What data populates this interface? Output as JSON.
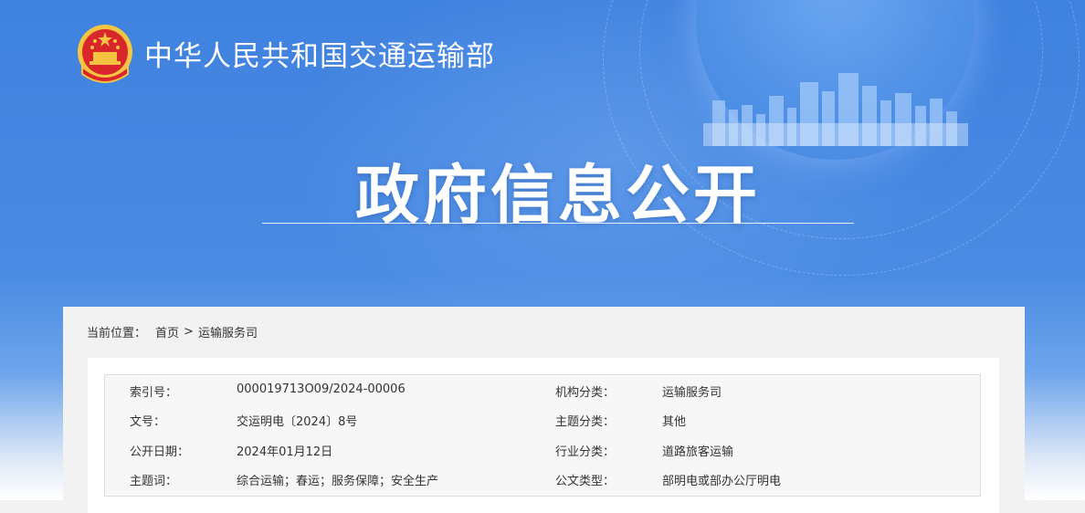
{
  "header": {
    "site_title": "中华人民共和国交通运输部",
    "page_title": "政府信息公开"
  },
  "breadcrumb": {
    "label": "当前位置：",
    "items": [
      "首页",
      "运输服务司"
    ],
    "separator": ">"
  },
  "meta": {
    "rows": [
      {
        "k1": "索引号：",
        "v1": "000019713O09/2024-00006",
        "k2": "机构分类：",
        "v2": "运输服务司"
      },
      {
        "k1": "文号：",
        "v1": "交运明电〔2024〕8号",
        "k2": "主题分类：",
        "v2": "其他"
      },
      {
        "k1": "公开日期：",
        "v1": "2024年01月12日",
        "k2": "行业分类：",
        "v2": "道路旅客运输"
      },
      {
        "k1": "主题词：",
        "v1": "综合运输；春运；服务保障；安全生产",
        "k2": "公文类型：",
        "v2": "部明电或部办公厅明电"
      }
    ]
  },
  "colors": {
    "banner_blue": "#3f82df",
    "text": "#333333",
    "panel_border": "#dcdcdc"
  },
  "icons": {
    "emblem": "national-emblem-icon",
    "skyline": "city-skyline-icon"
  }
}
